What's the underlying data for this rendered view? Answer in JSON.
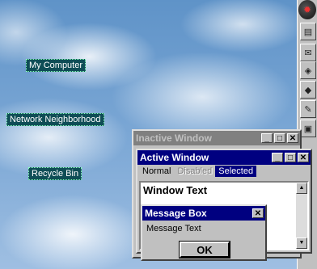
{
  "desktop": {
    "icons": [
      {
        "label": "My Computer"
      },
      {
        "label": "Network Neighborhood"
      },
      {
        "label": "Recycle Bin"
      }
    ]
  },
  "taskbar": {
    "items": [
      "start-icon",
      "notepad-icon",
      "envelope-icon",
      "network-icon",
      "shortcut-icon",
      "paint-icon",
      "media-icon"
    ]
  },
  "inactive_window": {
    "title": "Inactive Window",
    "buttons": {
      "minimize": "_",
      "maximize": "□",
      "close": "✕"
    }
  },
  "active_window": {
    "title": "Active Window",
    "buttons": {
      "minimize": "_",
      "maximize": "□",
      "close": "✕"
    },
    "menu": {
      "normal": "Normal",
      "disabled": "Disabled",
      "selected": "Selected"
    },
    "content_text": "Window Text"
  },
  "message_box": {
    "title": "Message Box",
    "close": "✕",
    "text": "Message Text",
    "ok_label": "OK"
  },
  "colors": {
    "active_title": "#000080",
    "inactive_title": "#808080",
    "face": "#c0c0c0",
    "desktop_label_bg": "#0f4d56"
  }
}
